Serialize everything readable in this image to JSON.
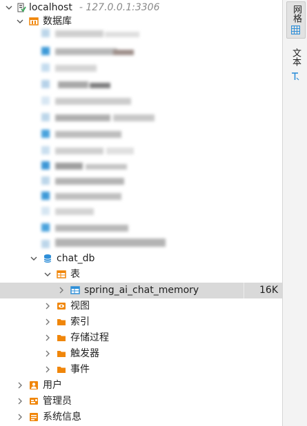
{
  "tree": {
    "connection": {
      "name": "localhost",
      "host": "- 127.0.0.1:3306"
    },
    "databases_label": "数据库",
    "database": {
      "name": "chat_db",
      "tables_label": "表",
      "table": {
        "name": "spring_ai_chat_memory",
        "size": "16K"
      },
      "views_label": "视图",
      "indexes_label": "索引",
      "procedures_label": "存储过程",
      "triggers_label": "触发器",
      "events_label": "事件"
    },
    "users_label": "用户",
    "admins_label": "管理员",
    "sysinfo_label": "系统信息"
  },
  "right_panel": {
    "grid_tab_label": "网格",
    "text_tab_label": "文本"
  },
  "colors": {
    "selected_row": "#d9d9d9",
    "folder_orange": "#f0860a",
    "db_blue": "#2f8fd8",
    "connection_green": "#3aa65a"
  }
}
